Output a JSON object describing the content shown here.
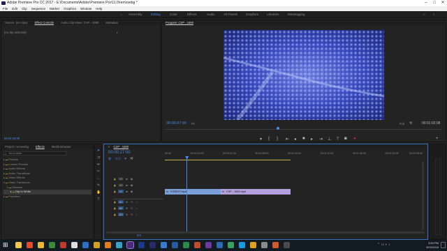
{
  "window": {
    "title": "Adobe Premiere Pro CC 2017 - E:\\Documents\\Adobe\\Premiere Pro\\11.0\\removebg *"
  },
  "menu": [
    "File",
    "Edit",
    "Clip",
    "Sequence",
    "Marker",
    "Graphics",
    "Window",
    "Help"
  ],
  "workspaces": [
    {
      "label": "Assembly",
      "active": false
    },
    {
      "label": "Editing",
      "active": true
    },
    {
      "label": "Color",
      "active": false
    },
    {
      "label": "Effects",
      "active": false
    },
    {
      "label": "Audio",
      "active": false
    },
    {
      "label": "All Panels",
      "active": false
    },
    {
      "label": "Graphics",
      "active": false
    },
    {
      "label": "Libraries",
      "active": false
    },
    {
      "label": "Metalogging",
      "active": false
    }
  ],
  "source_panel": {
    "tabs": [
      "Source: (no clips)",
      "Effect Controls",
      "Audio Clip Mixer: CSP - 1690",
      "Metadata"
    ],
    "active_tab": "Effect Controls",
    "empty_text": "(no clip selected)",
    "timecode": "00:01:23:00"
  },
  "program": {
    "title": "Program: CSP - 1690",
    "current_time": "00:00:27:00",
    "fit": "Fit",
    "quality": "Full",
    "duration": "00:01:02:08",
    "playhead_fraction": 0.41
  },
  "project_panel": {
    "tabs": [
      "Project: removebg",
      "Effects",
      "Media Browser"
    ],
    "active_tab": "Effects",
    "search_placeholder": "be to white",
    "folders": [
      {
        "label": "Presets",
        "open": false
      },
      {
        "label": "Lumetri Presets",
        "open": false
      },
      {
        "label": "Audio Effects",
        "open": false
      },
      {
        "label": "Audio Transitions",
        "open": false
      },
      {
        "label": "Video Effects",
        "open": false
      },
      {
        "label": "Video Transitions",
        "open": true
      },
      {
        "label": "Dissolve",
        "open": true,
        "indent": 1
      },
      {
        "label": "Dip to White",
        "open": false,
        "indent": 2,
        "selected": true
      },
      {
        "label": "Favorites",
        "open": false
      }
    ]
  },
  "timeline": {
    "tab": "CSP - 1690",
    "timecode": "00:00:27:00",
    "ruler": [
      "00:00",
      "00:00:16:00",
      "00:00:32:00",
      "00:00:48:00",
      "00:01:04:00",
      "00:01:20:00",
      "00:01:36:00",
      "00:01:52:00",
      "00:02:08:00"
    ],
    "video_tracks": [
      "V3",
      "V2",
      "V1"
    ],
    "audio_tracks": [
      "A1",
      "A2",
      "A3"
    ],
    "clips": [
      {
        "name": "CSP - 1690.mp4",
        "track": "V1",
        "color": "#b3a0dc"
      },
      {
        "name": "FOREST.mp4",
        "track": "V1",
        "color": "#7b9fd8"
      }
    ],
    "zero_label": "0.0",
    "playhead_fraction": 0.2
  },
  "taskbar": {
    "time": "3:59 PM",
    "date": "3/22/2018"
  }
}
